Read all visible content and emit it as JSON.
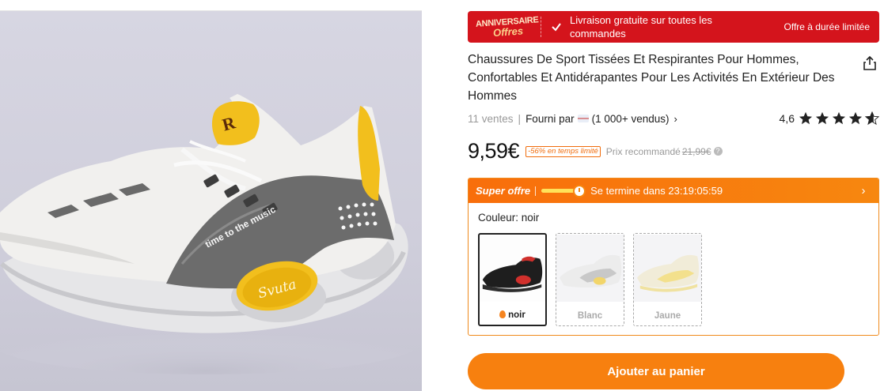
{
  "promo": {
    "badge_line1": "ANNIVERSAIRE",
    "badge_line2": "Offres",
    "shipping_text": "Livraison gratuite sur toutes les commandes",
    "limited_text": "Offre à durée limitée"
  },
  "product": {
    "title": "Chaussures De Sport Tissées Et Respirantes Pour Hommes, Confortables Et Antidérapantes Pour Les Activités En Extérieur Des Hommes",
    "sold": "11 ventes",
    "separator": "|",
    "supplier_label": "Fourni par",
    "supplier_count": "(1 000+ vendus)",
    "rating": "4,6",
    "rating_stars": 4.6,
    "price": "9,59€",
    "discount_badge": "-56% en temps limité",
    "recommended_label": "Prix recommandé",
    "recommended_price": "21,99€",
    "info_glyph": "?"
  },
  "offer": {
    "title": "Super offre",
    "ends_text": "Se termine dans 23:19:05:59",
    "timer_progress": 0.9
  },
  "color": {
    "label": "Couleur: noir",
    "options": [
      {
        "label": "noir",
        "selected": true
      },
      {
        "label": "Blanc",
        "selected": false
      },
      {
        "label": "Jaune",
        "selected": false
      }
    ]
  },
  "cart": {
    "button_label": "Ajouter au panier"
  },
  "shoe_print": {
    "text": "time to the music",
    "logo": "Svuta"
  },
  "colors": {
    "promo_red": "#d4141c",
    "accent_orange": "#f7800f",
    "shoe_yellow": "#f2bf1d",
    "shoe_gray": "#6c6c6c"
  }
}
